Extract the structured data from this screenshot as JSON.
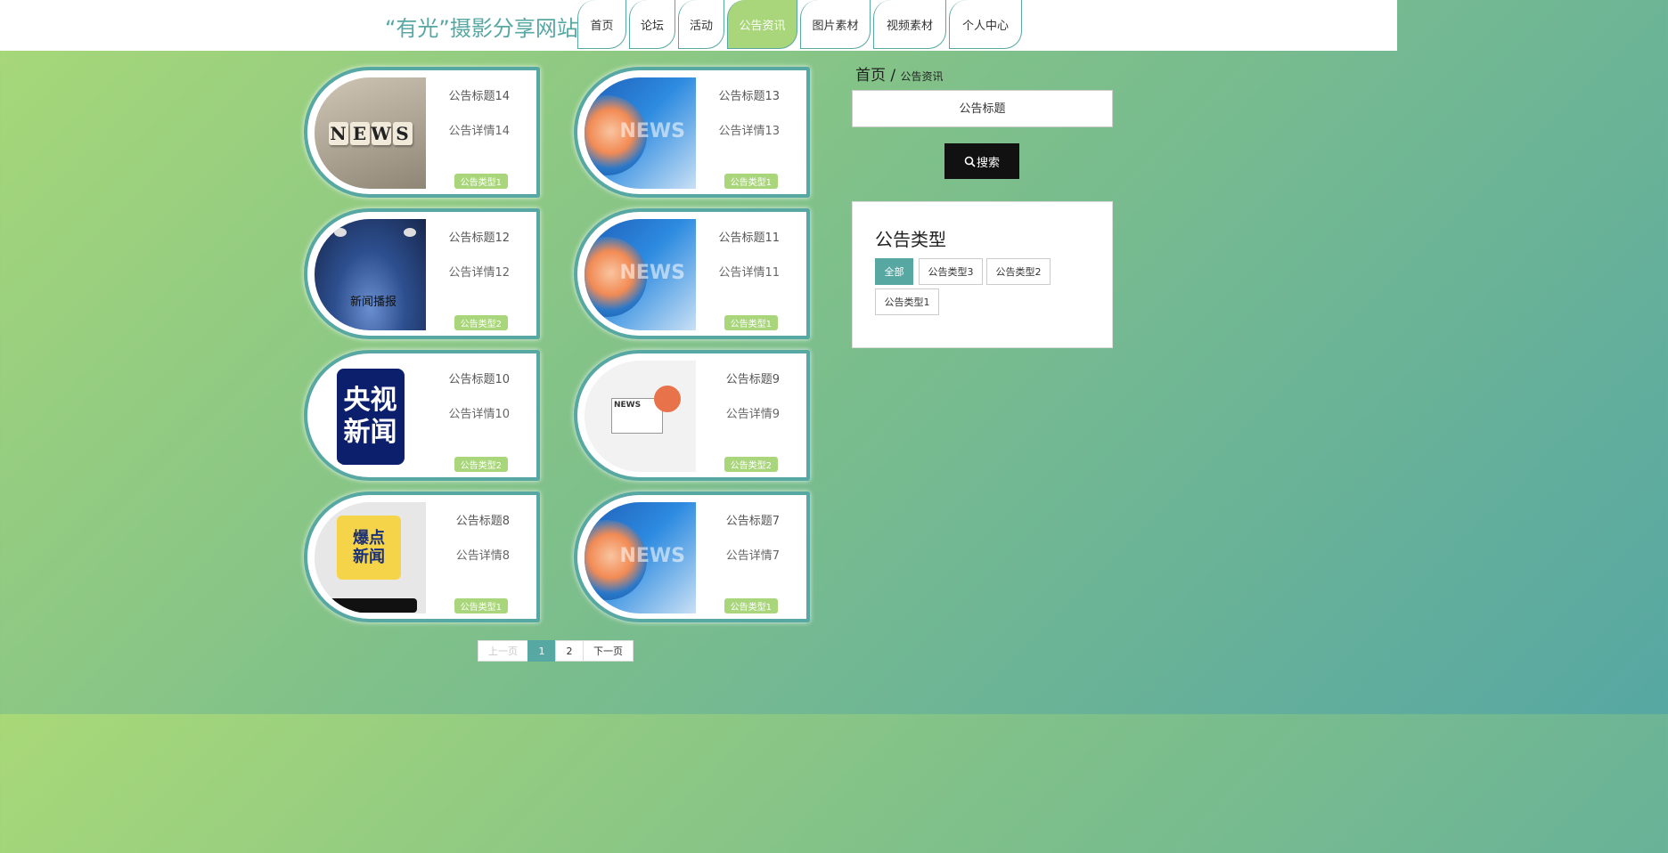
{
  "header": {
    "site_title": "“有光”摄影分享网站",
    "nav": [
      "首页",
      "论坛",
      "活动",
      "公告资讯",
      "图片素材",
      "视频素材",
      "个人中心"
    ],
    "active_nav": "公告资讯"
  },
  "cards": [
    {
      "title": "公告标题14",
      "detail": "公告详情14",
      "type": "公告类型1",
      "image": "news-cubes"
    },
    {
      "title": "公告标题13",
      "detail": "公告详情13",
      "type": "公告类型1",
      "image": "news-globe"
    },
    {
      "title": "公告标题12",
      "detail": "公告详情12",
      "type": "公告类型2",
      "image": "news-stage"
    },
    {
      "title": "公告标题11",
      "detail": "公告详情11",
      "type": "公告类型1",
      "image": "news-globe"
    },
    {
      "title": "公告标题10",
      "detail": "公告详情10",
      "type": "公告类型2",
      "image": "cctv-news"
    },
    {
      "title": "公告标题9",
      "detail": "公告详情9",
      "type": "公告类型2",
      "image": "newspaper"
    },
    {
      "title": "公告标题8",
      "detail": "公告详情8",
      "type": "公告类型1",
      "image": "burst-news"
    },
    {
      "title": "公告标题7",
      "detail": "公告详情7",
      "type": "公告类型1",
      "image": "news-globe"
    }
  ],
  "image_text": {
    "news_cubes": [
      "N",
      "E",
      "W",
      "S"
    ],
    "globe": "NEWS",
    "stage": "新闻播报",
    "cctv": [
      "央视",
      "新闻"
    ],
    "paper": "NEWS",
    "burst": [
      "爆点",
      "新闻"
    ]
  },
  "pagination": {
    "prev": "上一页",
    "pages": [
      "1",
      "2"
    ],
    "current": "1",
    "next": "下一页"
  },
  "sidebar": {
    "breadcrumb_home": "首页",
    "breadcrumb_sep": "/",
    "breadcrumb_current": "公告资讯",
    "search_placeholder": "公告标题",
    "search_button": "搜索",
    "category_title": "公告类型",
    "categories": [
      "全部",
      "公告类型3",
      "公告类型2",
      "公告类型1"
    ],
    "active_category": "全部"
  },
  "colors": {
    "accent": "#57a7a3",
    "active_green": "#a9d67b"
  }
}
